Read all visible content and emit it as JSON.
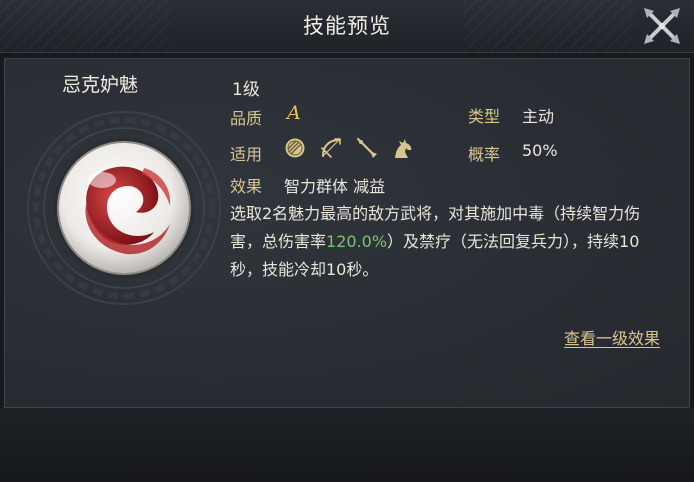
{
  "window": {
    "title": "技能预览"
  },
  "skill": {
    "name": "忌克妒魅",
    "level": "1级",
    "quality_label": "品质",
    "quality_value": "A",
    "type_label": "类型",
    "type_value": "主动",
    "applicable_label": "适用",
    "applicable_icons": [
      "shield-icon",
      "bow-icon",
      "spear-icon",
      "horse-icon"
    ],
    "rate_label": "概率",
    "rate_value": "50%",
    "effect_label": "效果",
    "effect_value": "智力群体 减益",
    "description": {
      "part1": "选取2名魅力最高的敌方武将，对其施加中毒（持续智力伤害，总伤害率",
      "highlight": "120.0%",
      "part2": "）及禁疗（无法回复兵力），持续10秒，技能冷却10秒。"
    },
    "emblem_icon": "red-swirl-emblem-icon"
  },
  "actions": {
    "view_level_one": "查看一级效果"
  },
  "colors": {
    "accent_gold": "#d9c58f",
    "quality_gold": "#e8c45e",
    "highlight_green": "#79c56f"
  }
}
